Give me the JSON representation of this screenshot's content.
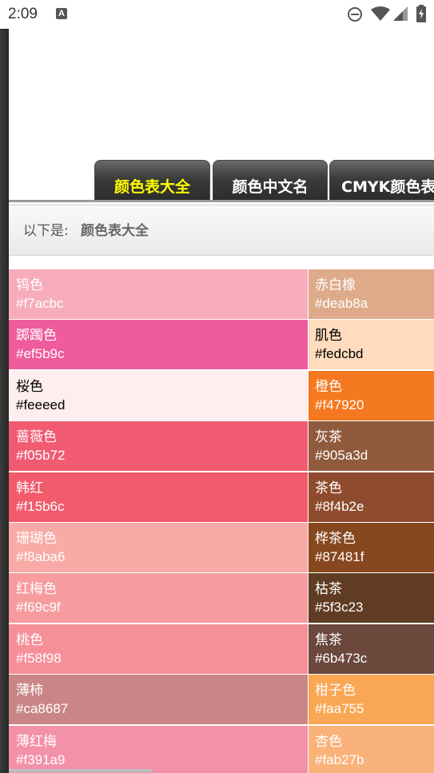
{
  "status_bar": {
    "time": "2:09",
    "notification_icon_letter": "A"
  },
  "tabs": [
    {
      "label": "颜色表大全",
      "active": true
    },
    {
      "label": "颜色中文名",
      "active": false
    },
    {
      "label": "CMYK颜色表",
      "active": false
    }
  ],
  "info": {
    "prefix": "以下是:",
    "title": "颜色表大全"
  },
  "left_colors": [
    {
      "name": "鸨色",
      "hex": "#f7acbc",
      "text": "light"
    },
    {
      "name": "踯躅色",
      "hex": "#ef5b9c",
      "text": "light"
    },
    {
      "name": "桜色",
      "hex": "#feeeed",
      "text": "dark"
    },
    {
      "name": "蔷薇色",
      "hex": "#f05b72",
      "text": "light"
    },
    {
      "name": "韩红",
      "hex": "#f15b6c",
      "text": "light"
    },
    {
      "name": "珊瑚色",
      "hex": "#f8aba6",
      "text": "light"
    },
    {
      "name": "红梅色",
      "hex": "#f69c9f",
      "text": "light"
    },
    {
      "name": "桃色",
      "hex": "#f58f98",
      "text": "light"
    },
    {
      "name": "薄柿",
      "hex": "#ca8687",
      "text": "light"
    },
    {
      "name": "薄红梅",
      "hex": "#f391a9",
      "text": "light"
    }
  ],
  "right_colors": [
    {
      "name": "赤白橡",
      "hex": "#deab8a",
      "text": "light"
    },
    {
      "name": "肌色",
      "hex": "#fedcbd",
      "text": "dark"
    },
    {
      "name": "橙色",
      "hex": "#f47920",
      "text": "light"
    },
    {
      "name": "灰茶",
      "hex": "#905a3d",
      "text": "light"
    },
    {
      "name": "茶色",
      "hex": "#8f4b2e",
      "text": "light"
    },
    {
      "name": "桦茶色",
      "hex": "#87481f",
      "text": "light"
    },
    {
      "name": "枯茶",
      "hex": "#5f3c23",
      "text": "light"
    },
    {
      "name": "焦茶",
      "hex": "#6b473c",
      "text": "light"
    },
    {
      "name": "柑子色",
      "hex": "#faa755",
      "text": "light"
    },
    {
      "name": "杏色",
      "hex": "#fab27b",
      "text": "light"
    }
  ]
}
